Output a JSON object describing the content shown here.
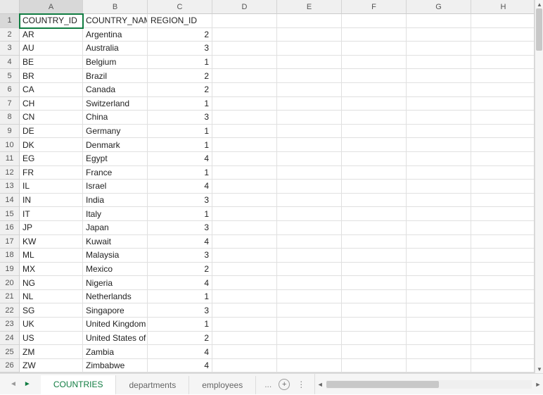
{
  "columns": [
    "A",
    "B",
    "C",
    "D",
    "E",
    "F",
    "G",
    "H"
  ],
  "activeCell": "A1",
  "headers": {
    "A": "COUNTRY_ID",
    "B": "COUNTRY_NAME",
    "C": "REGION_ID"
  },
  "rows": [
    {
      "A": "AR",
      "B": "Argentina",
      "C": "2"
    },
    {
      "A": "AU",
      "B": "Australia",
      "C": "3"
    },
    {
      "A": "BE",
      "B": "Belgium",
      "C": "1"
    },
    {
      "A": "BR",
      "B": "Brazil",
      "C": "2"
    },
    {
      "A": "CA",
      "B": "Canada",
      "C": "2"
    },
    {
      "A": "CH",
      "B": "Switzerland",
      "C": "1"
    },
    {
      "A": "CN",
      "B": "China",
      "C": "3"
    },
    {
      "A": "DE",
      "B": "Germany",
      "C": "1"
    },
    {
      "A": "DK",
      "B": "Denmark",
      "C": "1"
    },
    {
      "A": "EG",
      "B": "Egypt",
      "C": "4"
    },
    {
      "A": "FR",
      "B": "France",
      "C": "1"
    },
    {
      "A": "IL",
      "B": "Israel",
      "C": "4"
    },
    {
      "A": "IN",
      "B": "India",
      "C": "3"
    },
    {
      "A": "IT",
      "B": "Italy",
      "C": "1"
    },
    {
      "A": "JP",
      "B": "Japan",
      "C": "3"
    },
    {
      "A": "KW",
      "B": "Kuwait",
      "C": "4"
    },
    {
      "A": "ML",
      "B": "Malaysia",
      "C": "3"
    },
    {
      "A": "MX",
      "B": "Mexico",
      "C": "2"
    },
    {
      "A": "NG",
      "B": "Nigeria",
      "C": "4"
    },
    {
      "A": "NL",
      "B": "Netherlands",
      "C": "1"
    },
    {
      "A": "SG",
      "B": "Singapore",
      "C": "3"
    },
    {
      "A": "UK",
      "B": "United Kingdom",
      "C": "1"
    },
    {
      "A": "US",
      "B": "United States of America",
      "C": "2"
    },
    {
      "A": "ZM",
      "B": "Zambia",
      "C": "4"
    },
    {
      "A": "ZW",
      "B": "Zimbabwe",
      "C": "4"
    }
  ],
  "tabs": {
    "items": [
      "COUNTRIES",
      "departments",
      "employees"
    ],
    "activeIndex": 0,
    "more": "..."
  }
}
